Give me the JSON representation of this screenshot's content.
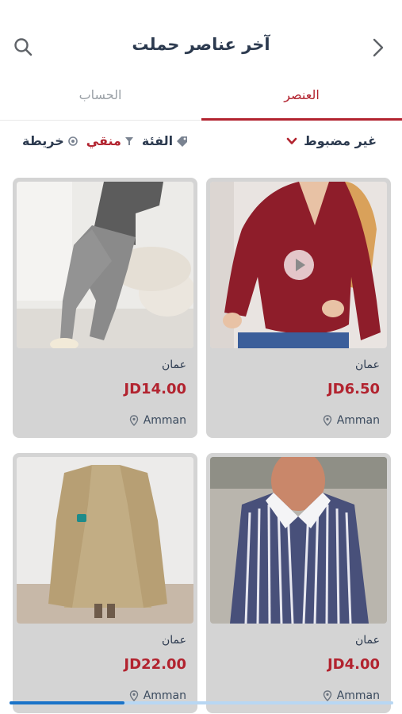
{
  "header": {
    "title": "آخر عناصر حملت",
    "search_icon": "search-icon",
    "back_icon": "chevron-right-icon"
  },
  "tabs": [
    {
      "label": "العنصر",
      "active": true
    },
    {
      "label": "الحساب",
      "active": false
    }
  ],
  "filter_bar": {
    "sort_label": "غير مضبوط",
    "category_label": "الفئة",
    "filtered_label": "منقي",
    "map_label": "خريطة"
  },
  "products": [
    {
      "city": "عمان",
      "price": "JD6.50",
      "location": "Amman",
      "has_video": true
    },
    {
      "city": "عمان",
      "price": "JD14.00",
      "location": "Amman",
      "has_video": false
    },
    {
      "city": "عمان",
      "price": "JD4.00",
      "location": "Amman",
      "has_video": false
    },
    {
      "city": "عمان",
      "price": "JD22.00",
      "location": "Amman",
      "has_video": false
    }
  ],
  "colors": {
    "accent": "#b2232f",
    "text_dark": "#2c3a4f",
    "card_bg": "#d4d4d4",
    "scroll_thumb": "#1a73c8"
  }
}
